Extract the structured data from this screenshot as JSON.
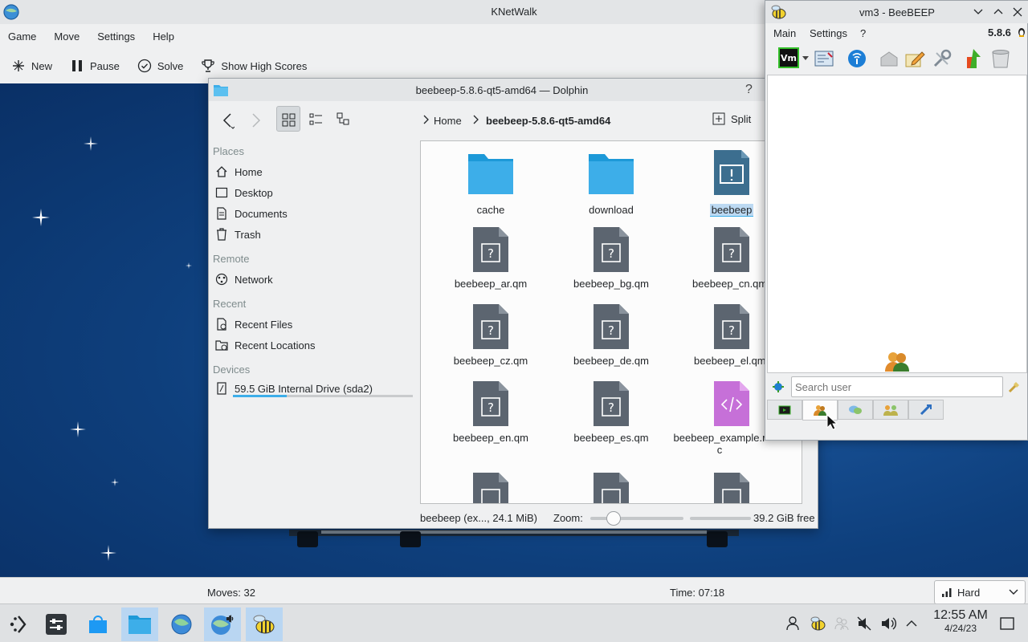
{
  "knetwalk": {
    "title": "KNetWalk",
    "menu": [
      "Game",
      "Move",
      "Settings",
      "Help"
    ],
    "toolbar": {
      "new": "New",
      "pause": "Pause",
      "solve": "Solve",
      "high_scores": "Show High Scores"
    },
    "status": {
      "moves": "Moves: 32",
      "time": "Time: 07:18",
      "difficulty": "Hard"
    }
  },
  "dolphin": {
    "title": "beebeep-5.8.6-qt5-amd64 — Dolphin",
    "help": "?",
    "breadcrumb": {
      "home": "Home",
      "current": "beebeep-5.8.6-qt5-amd64"
    },
    "split_label": "Split",
    "places": {
      "places_header": "Places",
      "home": "Home",
      "desktop": "Desktop",
      "documents": "Documents",
      "trash": "Trash",
      "remote_header": "Remote",
      "network": "Network",
      "recent_header": "Recent",
      "recent_files": "Recent Files",
      "recent_locations": "Recent Locations",
      "devices_header": "Devices",
      "drive": "59.5 GiB Internal Drive (sda2)"
    },
    "files": {
      "f0": "cache",
      "f1": "download",
      "f2": "beebeep",
      "f3": "beebeep_ar.qm",
      "f4": "beebeep_bg.qm",
      "f5": "beebeep_cn.qm",
      "f6": "beebeep_cz.qm",
      "f7": "beebeep_de.qm",
      "f8": "beebeep_el.qm",
      "f9": "beebeep_en.qm",
      "f10": "beebeep_es.qm",
      "f11": "beebeep_example.rc"
    },
    "status": {
      "selection": "beebeep (ex..., 24.1 MiB)",
      "zoom_label": "Zoom:",
      "free": "39.2 GiB free"
    },
    "zoom_level": 0.2,
    "disk_used_fraction": 0.3
  },
  "beebeep": {
    "title": "vm3 - BeeBEEP",
    "menu": {
      "main": "Main",
      "settings": "Settings",
      "help": "?"
    },
    "version": "5.8.6",
    "toolbar_icons": [
      "vm-status-icon",
      "chevron-down-icon",
      "preferences-icon",
      "network-icon",
      "group-icon",
      "edit-icon",
      "tools-icon",
      "update-icon",
      "trash-icon"
    ],
    "search_placeholder": "Search user",
    "tabs": [
      "vm-tab",
      "users-tab",
      "chats-tab",
      "groups-tab",
      "shares-tab"
    ]
  },
  "taskbar": {
    "clock_time": "12:55 AM",
    "clock_date": "4/24/23"
  },
  "colors": {
    "accent": "#3daee9",
    "folder": "#3daee9",
    "file_icon": "#5c6570",
    "desktop": "#0e3f7c",
    "selection": "#bcd9f2"
  }
}
